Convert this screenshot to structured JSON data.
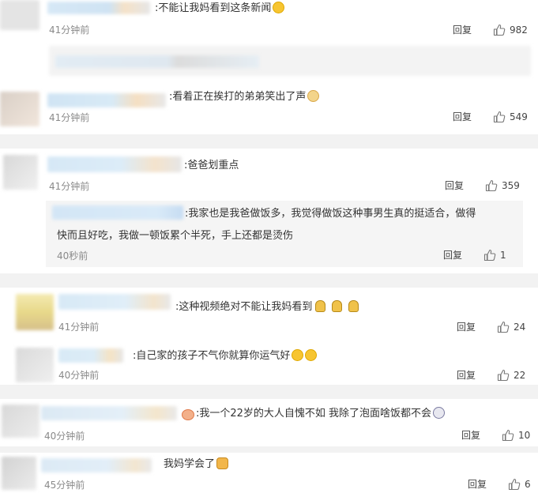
{
  "comments": [
    {
      "text": ":不能让我妈看到这条新闻",
      "time": "41分钟前",
      "reply": "回复",
      "likes": "982",
      "emojis": [
        "laugh-cry"
      ]
    },
    {
      "text": ":看着正在挨打的弟弟笑出了声",
      "time": "41分钟前",
      "reply": "回复",
      "likes": "549",
      "emojis": [
        "dog-face"
      ]
    },
    {
      "text": ":爸爸划重点",
      "time": "41分钟前",
      "reply": "回复",
      "likes": "359",
      "emojis": []
    },
    {
      "text": ":这种视频绝对不能让我妈看到",
      "time": "41分钟前",
      "reply": "回复",
      "likes": "24",
      "emojis": [
        "sad-doll",
        "sad-doll",
        "sad-doll"
      ]
    },
    {
      "text": ":自己家的孩子不气你就算你运气好",
      "time": "40分钟前",
      "reply": "回复",
      "likes": "22",
      "emojis": [
        "laugh-cry",
        "laugh-cry"
      ]
    },
    {
      "text": ":我一个22岁的大人自愧不如  我除了泡面啥饭都不会",
      "time": "40分钟前",
      "reply": "回复",
      "likes": "10",
      "emojis": [
        "shocked"
      ]
    },
    {
      "text": "我妈学会了",
      "time": "45分钟前",
      "reply": "回复",
      "likes": "6",
      "emojis": [
        "thumbs-up"
      ]
    }
  ],
  "subreply": {
    "line1": ":我家也是我爸做饭多，我觉得做饭这种事男生真的挺适合，做得",
    "line2": "快而且好吃，我做一顿饭累个半死，手上还都是烫伤",
    "time": "40秒前",
    "reply": "回复",
    "likes": "1"
  },
  "colors": {
    "text": "#333333",
    "meta": "#8a8a8a",
    "divider": "#f2f2f2",
    "subreply_bg": "#f5f5f5"
  }
}
